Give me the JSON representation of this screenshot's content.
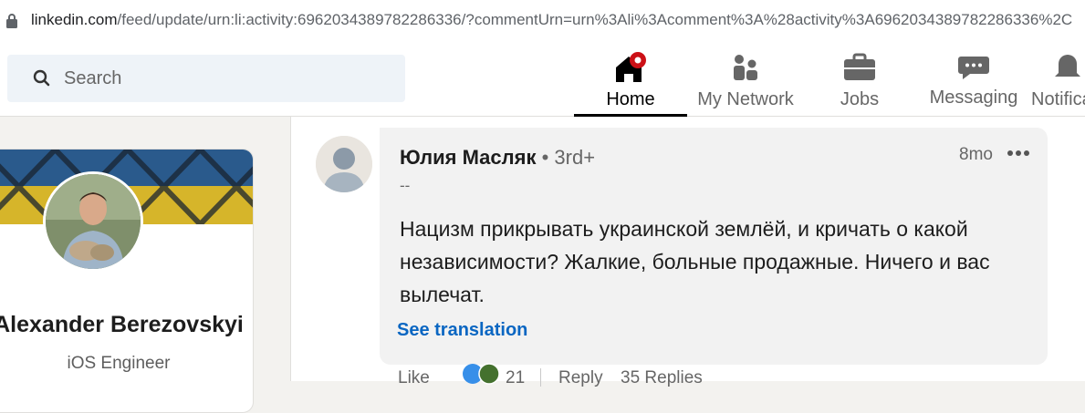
{
  "browser": {
    "url_host": "linkedin.com",
    "url_path": "/feed/update/urn:li:activity:6962034389782286336/?commentUrn=urn%3Ali%3Acomment%3A%28activity%3A6962034389782286336%2C"
  },
  "nav": {
    "search_placeholder": "Search",
    "home_label": "Home",
    "network_label": "My Network",
    "jobs_label": "Jobs",
    "messaging_label": "Messaging",
    "notifications_label": "Notifications"
  },
  "profile": {
    "name": "Alexander Berezovskyi",
    "headline": "iOS Engineer"
  },
  "comment": {
    "author": "Юлия Масляк",
    "degree": "• 3rd+",
    "subtitle": "--",
    "time": "8mo",
    "text": "Нацизм прикрывать украинской землёй, и кричать о какой независимости? Жалкие, больные продажные. Ничего и вас вылечат.",
    "translate_label": "See translation"
  },
  "actions": {
    "like_label": "Like",
    "reactions_count": "21",
    "reply_label": "Reply",
    "replies_label": "35 Replies"
  },
  "colors": {
    "accent": "#0a66c2",
    "notification_badge": "#cc1016",
    "bubble_bg": "#f2f2f2"
  }
}
